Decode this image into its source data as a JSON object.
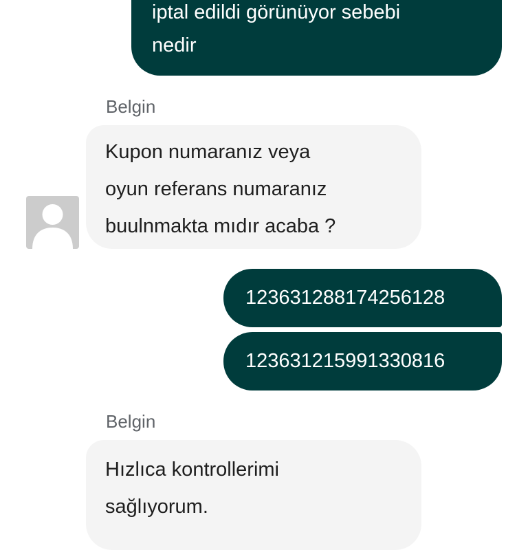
{
  "messages": [
    {
      "direction": "outgoing",
      "lines": [
        "iptal edildi görünüyor sebebi",
        "nedir"
      ]
    },
    {
      "direction": "incoming",
      "sender": "Belgin",
      "lines": [
        "Kupon numaranız veya",
        "oyun referans numaranız",
        "buulnmakta mıdır acaba ?"
      ]
    },
    {
      "direction": "outgoing",
      "lines": [
        "123631288174256128"
      ]
    },
    {
      "direction": "outgoing",
      "lines": [
        "123631215991330816"
      ]
    },
    {
      "direction": "incoming",
      "sender": "Belgin",
      "lines": [
        "Hızlıca kontrollerimi",
        "sağlıyorum."
      ]
    }
  ],
  "avatar": {
    "icon": "default-user-avatar",
    "color": "#cccccc"
  },
  "colors": {
    "outgoing_bubble": "#003c3c",
    "incoming_bubble": "#f4f4f4",
    "sender_text": "#5f6368"
  }
}
